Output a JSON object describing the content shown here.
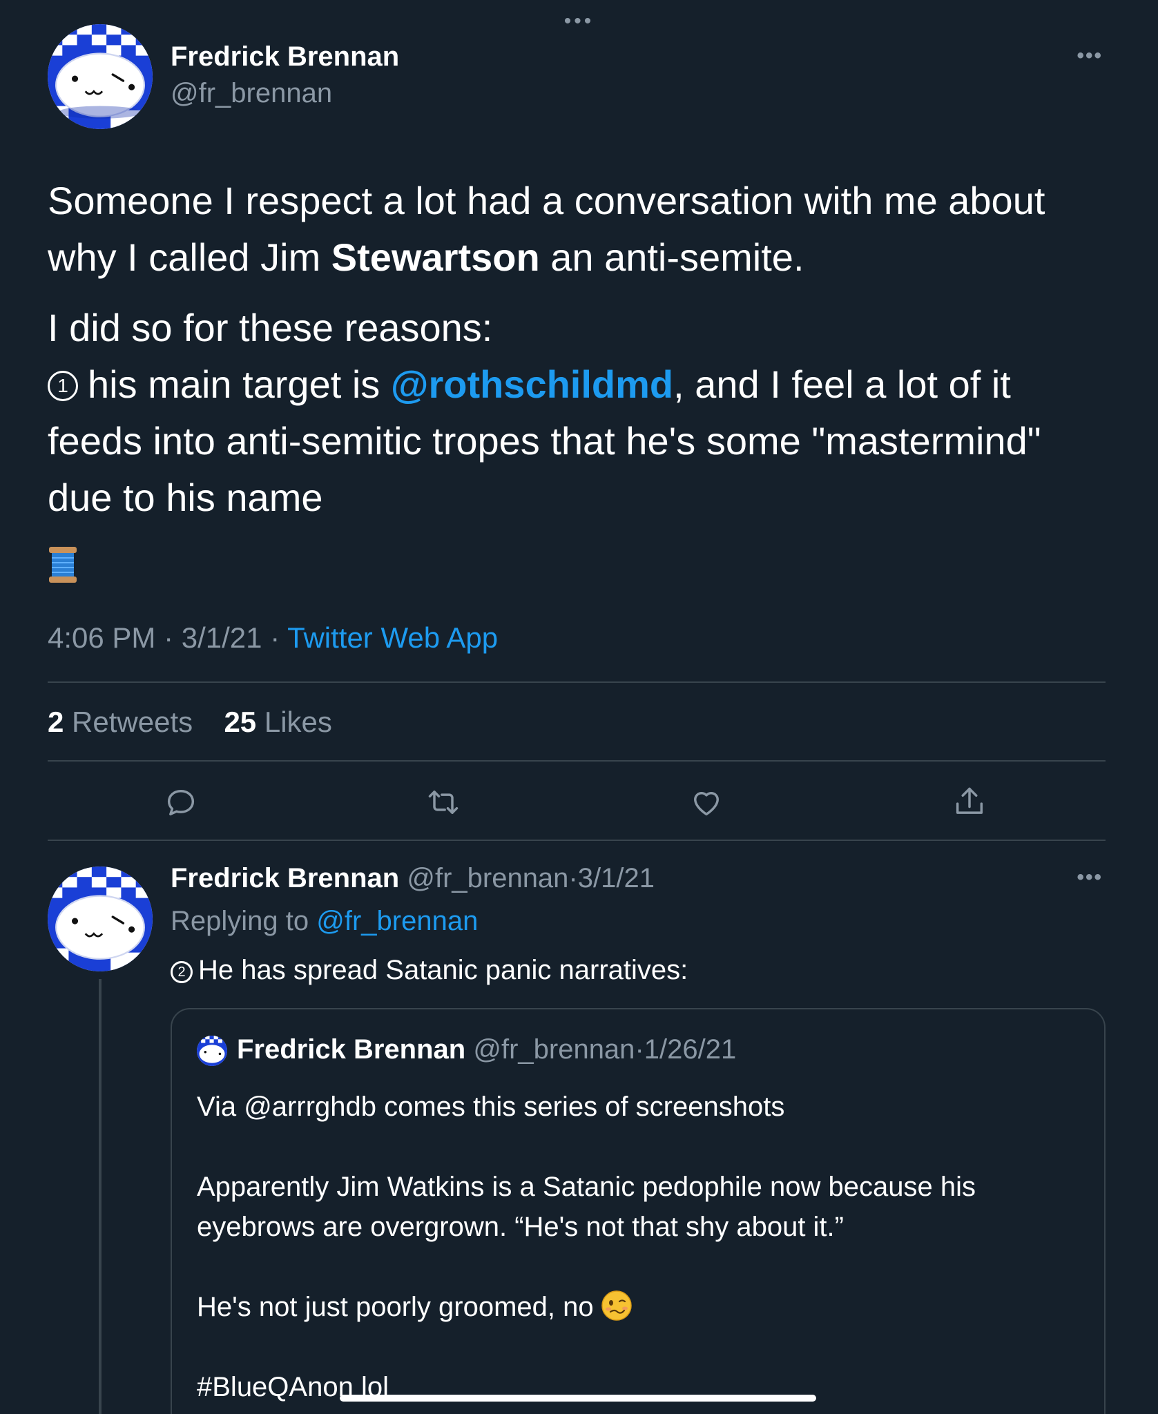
{
  "top_grip": "•••",
  "main_tweet": {
    "author_name": "Fredrick Brennan",
    "author_handle": "@fr_brennan",
    "more_label": "•••",
    "line1_pre": "Someone I respect a lot had a conversation with me about why I called Jim ",
    "line1_bold": "Stewartson",
    "line1_post": " an anti-semite.",
    "line2": "I did so for these reasons:",
    "point_number": "1",
    "point_pre": "his main target is ",
    "point_mention": "@rothschildmd",
    "point_post": ", and I feel a lot of it feeds into anti-semitic tropes that he's some \"mastermind\" due to his name",
    "emoji": "spool-of-thread",
    "time": "4:06 PM",
    "date": "3/1/21",
    "source": "Twitter Web App",
    "retweets_count": "2",
    "retweets_label": "Retweets",
    "likes_count": "25",
    "likes_label": "Likes"
  },
  "actions": [
    "reply-icon",
    "retweet-icon",
    "like-icon",
    "share-icon"
  ],
  "reply": {
    "author_name": "Fredrick Brennan",
    "author_handle": "@fr_brennan",
    "date": "3/1/21",
    "more_label": "•••",
    "replying_label": "Replying to",
    "replying_handle": "@fr_brennan",
    "point_number": "2",
    "text": "He has spread Satanic panic narratives:"
  },
  "quote": {
    "author_name": "Fredrick Brennan",
    "author_handle": "@fr_brennan",
    "date": "1/26/21",
    "p1": "Via @arrrghdb comes this series of screenshots",
    "p2": "Apparently Jim Watkins is a Satanic pedophile now because his eyebrows are overgrown. “He's not that shy about it.”",
    "p3": "He's not just poorly groomed, no",
    "p3_emoji": "woozy-face",
    "p4": "#BlueQAnon lol"
  },
  "colors": {
    "background": "#15202b",
    "accent": "#1d9bf0",
    "muted": "#8b98a5",
    "divider": "#38444d"
  }
}
